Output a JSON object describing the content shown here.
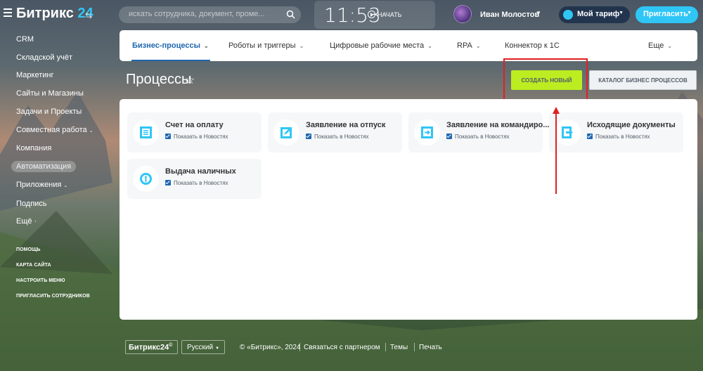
{
  "header": {
    "logo_text": "Битрикс",
    "logo_num": "24",
    "logo_arrows": "⇆",
    "search_placeholder": "искать сотрудника, документ, проме...",
    "clock_time": "11:53",
    "clock_action": "НАЧАТЬ",
    "user_name": "Иван Молостов",
    "tariff_label": "Мой тариф",
    "invite_label": "Пригласить"
  },
  "sidebar": {
    "items": [
      {
        "label": "CRM"
      },
      {
        "label": "Складской учёт"
      },
      {
        "label": "Маркетинг"
      },
      {
        "label": "Сайты и Магазины"
      },
      {
        "label": "Задачи и Проекты"
      },
      {
        "label": "Совместная работа"
      },
      {
        "label": "Компания"
      },
      {
        "label": "Автоматизация"
      },
      {
        "label": "Приложения"
      },
      {
        "label": "Подпись"
      },
      {
        "label": "Ещё ·"
      }
    ],
    "links": [
      {
        "label": "ПОМОЩЬ"
      },
      {
        "label": "КАРТА САЙТА"
      },
      {
        "label": "НАСТРОИТЬ МЕНЮ"
      },
      {
        "label": "ПРИГЛАСИТЬ СОТРУДНИКОВ"
      }
    ],
    "active_item": "Автоматизация"
  },
  "tabs": [
    {
      "label": "Бизнес-процессы",
      "active": true
    },
    {
      "label": "Роботы и триггеры"
    },
    {
      "label": "Цифровые рабочие места"
    },
    {
      "label": "RPA"
    },
    {
      "label": "Коннектор к 1С"
    },
    {
      "label": "Еще"
    }
  ],
  "page": {
    "title": "Процессы",
    "create_button": "СОЗДАТЬ НОВЫЙ",
    "catalog_button": "КАТАЛОГ БИЗНЕС ПРОЦЕССОВ"
  },
  "processes": [
    {
      "name": "Счет на оплату",
      "checkbox_label": "Показать в Новостях",
      "icon": "invoice-icon"
    },
    {
      "name": "Заявление на отпуск",
      "checkbox_label": "Показать в Новостях",
      "icon": "vacation-icon"
    },
    {
      "name": "Заявление на командиро...",
      "checkbox_label": "Показать в Новостях",
      "icon": "trip-icon"
    },
    {
      "name": "Исходящие документы",
      "checkbox_label": "Показать в Новостях",
      "icon": "outgoing-docs-icon"
    },
    {
      "name": "Выдача наличных",
      "checkbox_label": "Показать в Новостях",
      "icon": "cash-icon"
    }
  ],
  "footer": {
    "logo": "Битрикс24",
    "logo_mark": "©",
    "language": "Русский",
    "copyright": "© «Битрикс», 2024",
    "partner_link": "Связаться с партнером",
    "themes_link": "Темы",
    "print_link": "Печать"
  },
  "colors": {
    "accent_blue": "#2fc6f6",
    "active_tab": "#2067b0",
    "create_green": "#bbed21",
    "highlight_red": "#e02020"
  }
}
